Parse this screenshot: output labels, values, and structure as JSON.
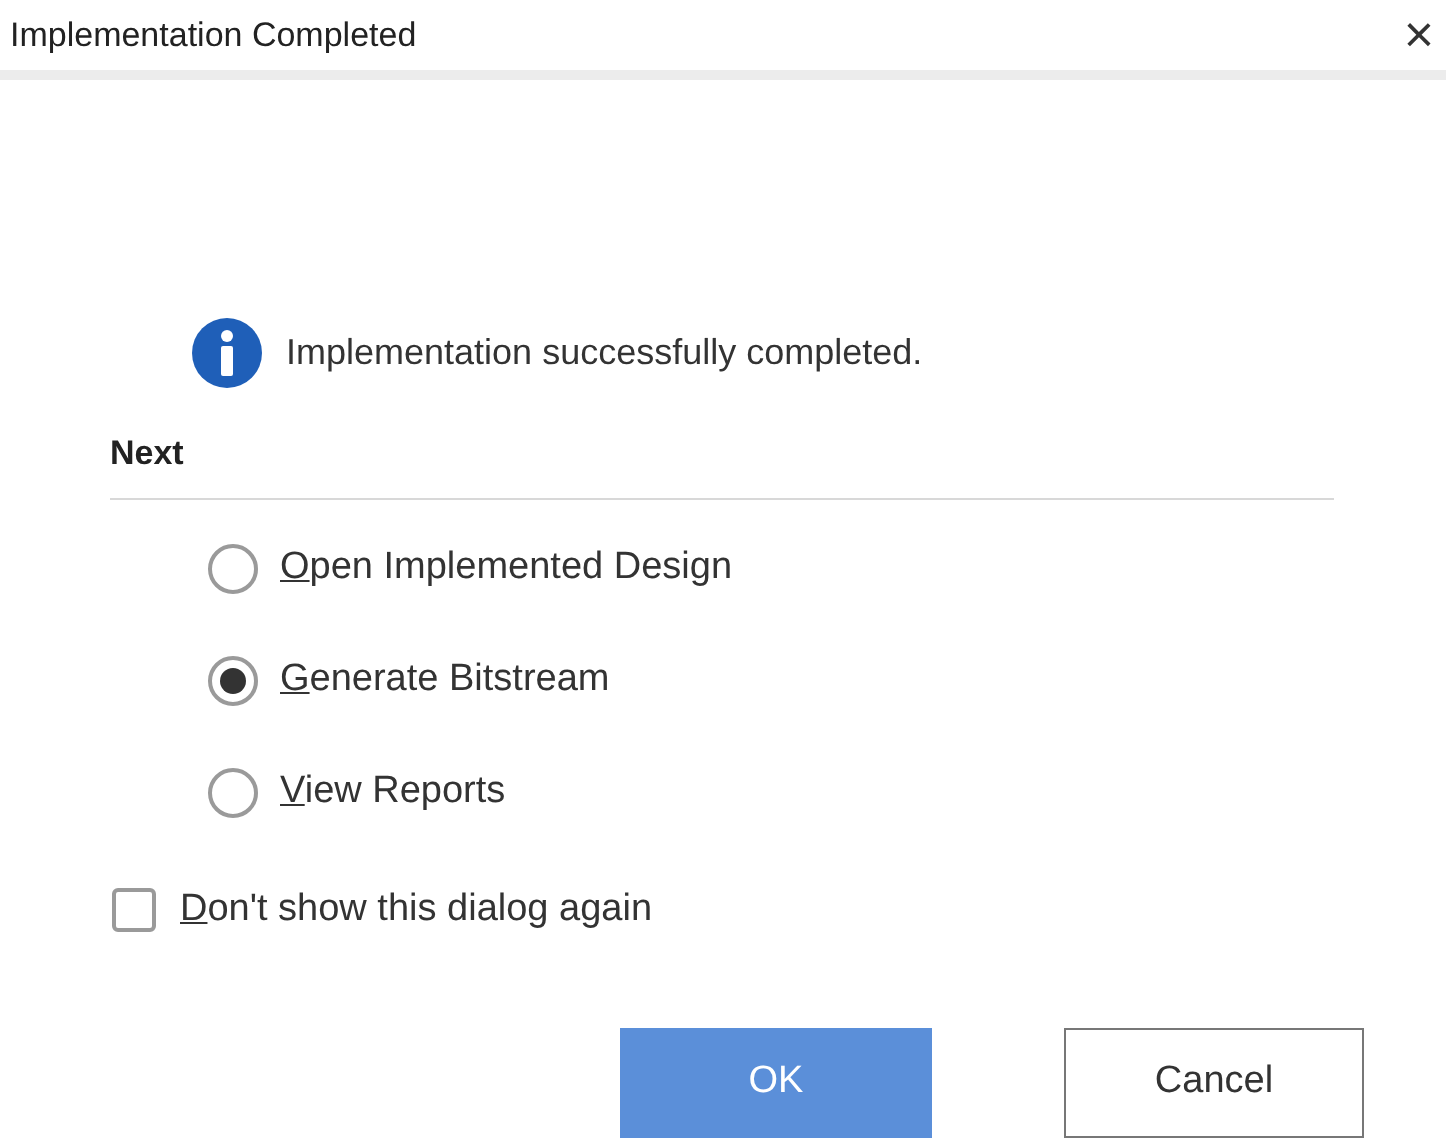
{
  "window": {
    "title": "Implementation Completed",
    "close": "×"
  },
  "message": "Implementation successfully completed.",
  "next": {
    "heading": "Next",
    "options": [
      {
        "label": "Open Implemented Design",
        "mnemonic": true,
        "selected": false
      },
      {
        "label": "Generate Bitstream",
        "mnemonic": true,
        "selected": true
      },
      {
        "label": "View Reports",
        "mnemonic": true,
        "selected": false
      }
    ]
  },
  "dont_show": {
    "label": "Don't show this dialog again",
    "mnemonic": true,
    "checked": false
  },
  "buttons": [
    {
      "label": "OK",
      "kind": "primary"
    },
    {
      "label": "Cancel",
      "kind": "secondary"
    }
  ]
}
